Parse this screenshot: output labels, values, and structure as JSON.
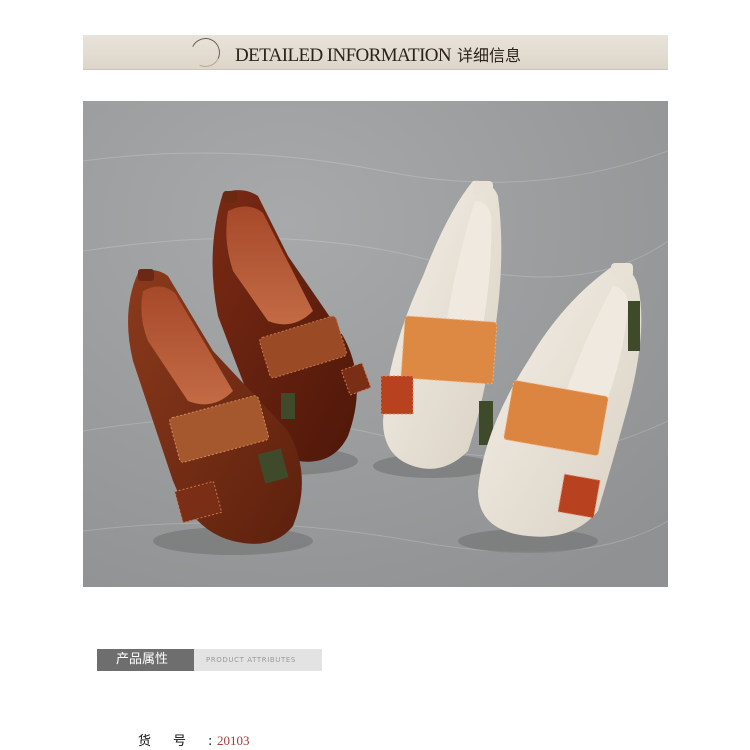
{
  "header": {
    "title_en": "DETAILED INFORMATION",
    "title_cn": "详细信息"
  },
  "photo": {
    "subject": "product-photo-shoes",
    "colors": {
      "background": "#9ea0a1",
      "brown": "#7a2e16",
      "dark_brown": "#5a1f0d",
      "cream": "#ece6dc",
      "orange": "#dc8540",
      "rust": "#b8421f",
      "olive": "#3f4a2a"
    }
  },
  "attributes": {
    "heading_cn": "产品属性",
    "heading_en": "PRODUCT ATTRIBUTES",
    "rows": [
      {
        "label": "货号",
        "colon": ":",
        "value": "20103"
      }
    ]
  }
}
